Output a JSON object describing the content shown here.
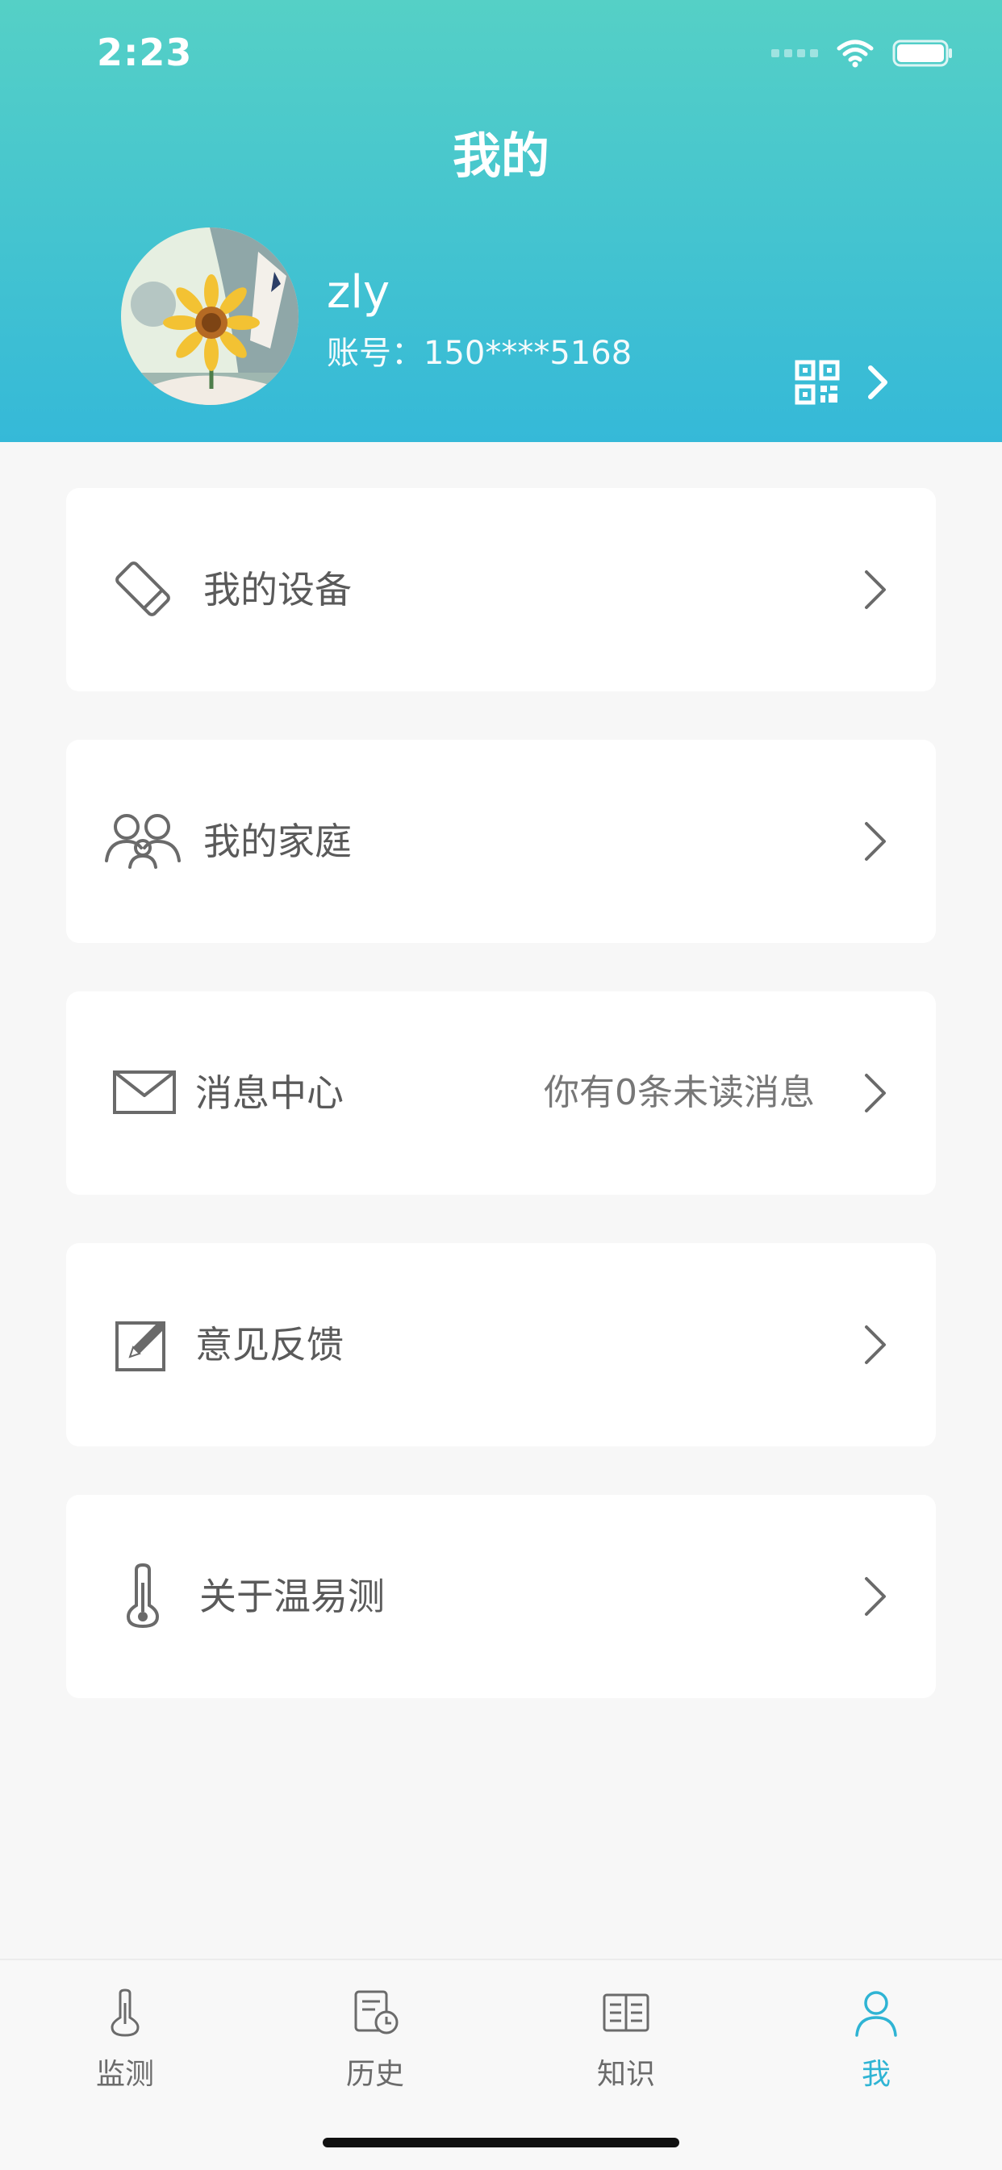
{
  "status_bar": {
    "time": "2:23"
  },
  "header": {
    "title": "我的",
    "username": "zly",
    "account": "账号：150****5168"
  },
  "menu": {
    "devices": {
      "label": "我的设备",
      "icon": "device-icon"
    },
    "family": {
      "label": "我的家庭",
      "icon": "family-icon"
    },
    "messages": {
      "label": "消息中心",
      "info": "你有0条未读消息",
      "icon": "mail-icon"
    },
    "feedback": {
      "label": "意见反馈",
      "icon": "edit-icon"
    },
    "about": {
      "label": "关于温易测",
      "icon": "thermometer-icon"
    }
  },
  "tabbar": {
    "monitor": "监测",
    "history": "历史",
    "knowledge": "知识",
    "me": "我"
  },
  "colors": {
    "header_top": "#55d0c6",
    "header_bottom": "#35b9d8",
    "active_tab": "#2fb4d4"
  }
}
